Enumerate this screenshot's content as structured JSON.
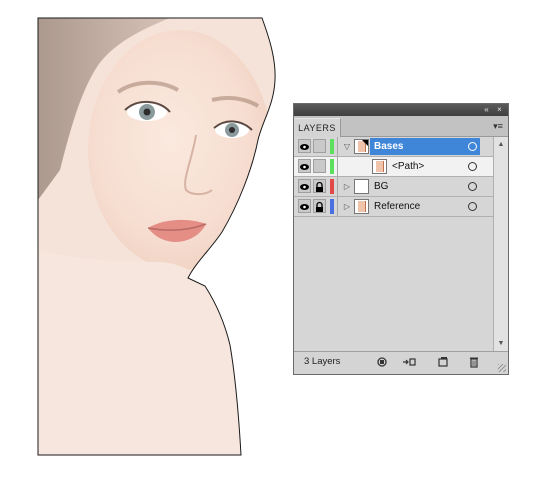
{
  "panel": {
    "tab_label": "LAYERS",
    "collapse_glyph": "«",
    "close_glyph": "×",
    "menu_glyph": "▾≡",
    "layers": [
      {
        "name": "Bases",
        "color": "#5de05d",
        "selected": true,
        "expanded": true,
        "visible": true,
        "locked": false,
        "thumb_icon": "portrait-thumb-icon"
      },
      {
        "name": "<Path>",
        "color": "#5de05d",
        "selected": false,
        "sublayer": true,
        "visible": true,
        "locked": false,
        "thumb_icon": "portrait-thumb-icon"
      },
      {
        "name": "BG",
        "color": "#e24848",
        "selected": false,
        "expanded": false,
        "visible": true,
        "locked": true,
        "thumb_icon": "blank-thumb-icon"
      },
      {
        "name": "Reference",
        "color": "#4a6fe0",
        "selected": false,
        "expanded": false,
        "visible": true,
        "locked": true,
        "thumb_icon": "portrait-thumb-icon"
      }
    ],
    "footer": {
      "count_label": "3 Layers",
      "buttons": [
        "make-clipping-mask-icon",
        "create-sublayer-icon",
        "new-layer-icon",
        "trash-icon"
      ]
    }
  }
}
